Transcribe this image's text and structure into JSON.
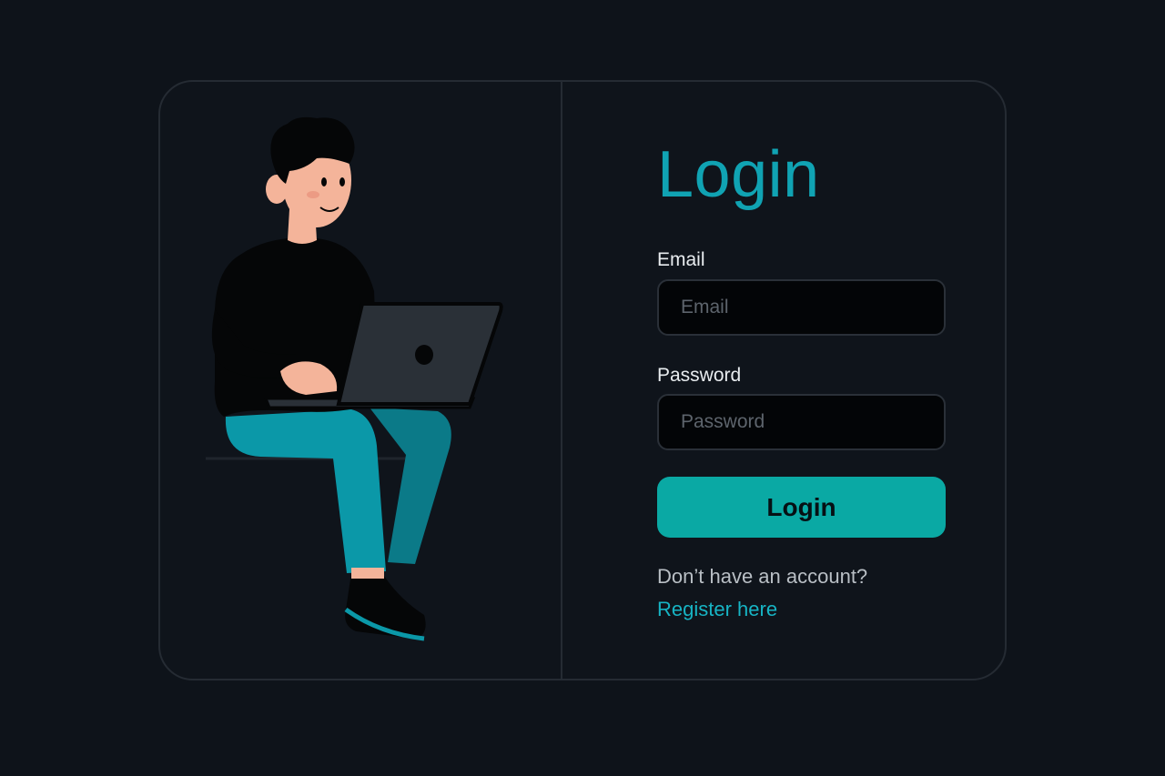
{
  "login": {
    "title": "Login",
    "email_label": "Email",
    "email_placeholder": "Email",
    "email_value": "",
    "password_label": "Password",
    "password_placeholder": "Password",
    "password_value": "",
    "submit_label": "Login",
    "no_account_text": "Don’t have an account?",
    "register_link": "Register here"
  },
  "illustration": {
    "icon": "person-with-laptop-illustration"
  },
  "colors": {
    "background": "#0e131a",
    "card": "#0f141b",
    "accent": "#10a3b3",
    "button": "#0aa9a4",
    "input_background": "#030507",
    "link": "#17b4c4"
  }
}
